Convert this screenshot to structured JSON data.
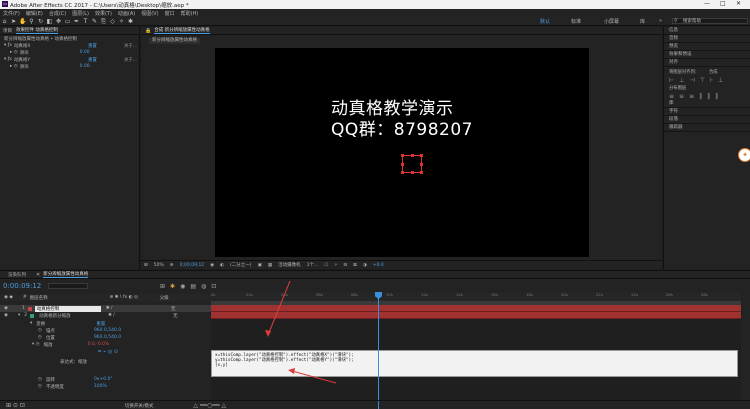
{
  "titlebar": {
    "logo": "Ae",
    "title": "Adobe After Effects CC 2017 - C:\\Users\\动真格\\Desktop\\缩放.aep *",
    "minimize": "—",
    "maximize": "□",
    "close": "✕"
  },
  "menu": [
    "文件(F)",
    "编辑(E)",
    "合成(C)",
    "图层(L)",
    "效果(T)",
    "动画(A)",
    "视图(V)",
    "窗口",
    "帮助(H)"
  ],
  "workspaces": {
    "default": "默认",
    "standard": "标准",
    "small_screen": "小屏幕",
    "libraries": "库",
    "overflow": "»",
    "search_placeholder": "搜索帮助"
  },
  "effect_controls": {
    "tabs": [
      "项目",
      "效果控件 动真格控制"
    ],
    "subtitle": "新分辨缩放属性动真格 • 动真格控制",
    "items": [
      {
        "name": "动真格X",
        "reset": "重置",
        "about": "关于..."
      },
      {
        "name": "滑块",
        "value": "0.00"
      },
      {
        "name": "动真格Y",
        "reset": "重置",
        "about": "关于..."
      },
      {
        "name": "滑块",
        "value": "0.00"
      }
    ]
  },
  "composition": {
    "tab_label": "合成 新分辨缩放属性动真格",
    "sub_tab": "新分辨缩放属性动真格",
    "overlay_line1": "动真格教学演示",
    "overlay_line2": "QQ群：8798207",
    "zoom": "50%",
    "timecode": "0;00;09;12",
    "resolution": "(二分之一)",
    "camera": "活动摄像机",
    "views": "1个...",
    "exposure": "+0.0"
  },
  "right_panels": [
    "信息",
    "音频",
    "预览",
    "效果和预设",
    "对齐",
    "库",
    "字符",
    "段落",
    "跟踪器"
  ],
  "align": {
    "label": "将图层对齐到：",
    "target": "合成",
    "distribute": "分布图层"
  },
  "timeline": {
    "tabs": [
      "渲染队列",
      "新分辨缩放属性动真格"
    ],
    "timecode": "0:00:09:12",
    "col_source": "图层名称",
    "col_mode": "父级",
    "ruler": [
      "0s",
      "02s",
      "04s",
      "06s",
      "08s",
      "10s",
      "12s",
      "14s",
      "16s",
      "18s",
      "20s",
      "22s",
      "24s",
      "26s",
      "28s"
    ],
    "layers": [
      {
        "num": "1",
        "name": "动真格控制",
        "parent": "无",
        "color": "#c24848"
      },
      {
        "num": "2",
        "name": "动真格新分缩放",
        "parent": "无",
        "color": "#2aa27a"
      }
    ],
    "transform": "变换",
    "transform_reset": "重置",
    "props": [
      {
        "name": "锚点",
        "value": "960.0,540.0"
      },
      {
        "name": "位置",
        "value": "960.0,540.0"
      },
      {
        "name": "缩放",
        "value": "0.0,-0.0%"
      },
      {
        "name": "表达式：缩放"
      },
      {
        "name": "旋转",
        "value": "0x+0.0°"
      },
      {
        "name": "不透明度",
        "value": "100%"
      }
    ],
    "expression_lines": [
      "x=thisComp.layer(\"动真格控制\").effect(\"动真格X\")(\"滑块\");",
      "y=thisComp.layer(\"动真格控制\").effect(\"动真格Y\")(\"滑块\");",
      "[x,y]"
    ],
    "footer": "切换开关/模式"
  }
}
